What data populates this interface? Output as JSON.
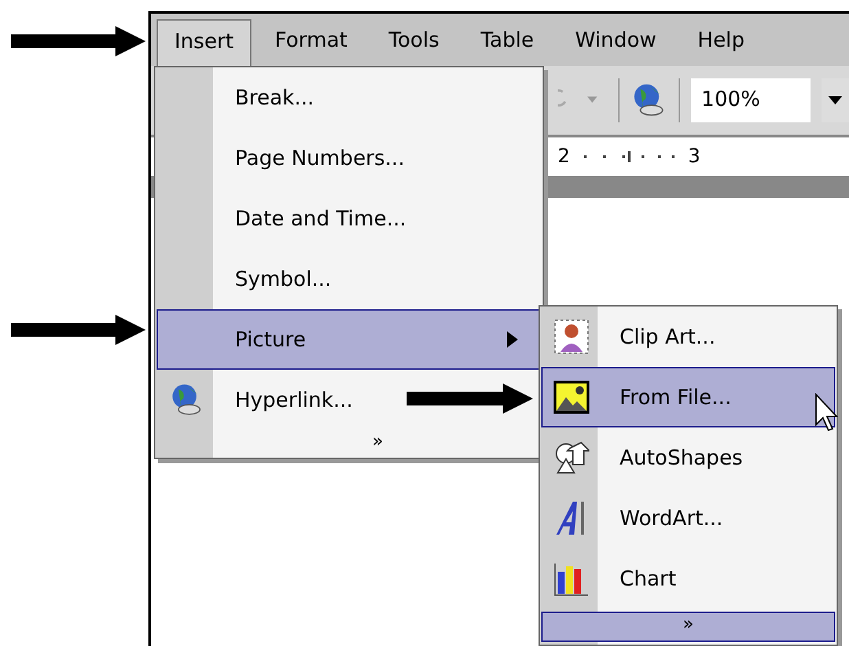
{
  "menu_bar": [
    {
      "label": "Insert",
      "selected": true
    },
    {
      "label": "Format",
      "selected": false
    },
    {
      "label": "Tools",
      "selected": false
    },
    {
      "label": "Table",
      "selected": false
    },
    {
      "label": "Window",
      "selected": false
    },
    {
      "label": "Help",
      "selected": false
    }
  ],
  "toolbar": {
    "zoom": "100%"
  },
  "ruler": {
    "marks": [
      "2",
      "3"
    ]
  },
  "insert_menu": {
    "items": [
      {
        "label": "Break...",
        "selected": false
      },
      {
        "label": "Page Numbers...",
        "selected": false
      },
      {
        "label": "Date and Time...",
        "selected": false
      },
      {
        "label": "Symbol...",
        "selected": false
      },
      {
        "label": "Picture",
        "selected": true,
        "kind": "submenu"
      },
      {
        "label": "Hyperlink...",
        "selected": false,
        "kind": "globe"
      }
    ],
    "more": "»"
  },
  "picture_menu": {
    "items": [
      {
        "label": "Clip Art...",
        "selected": false,
        "kind": "clipart"
      },
      {
        "label": "From File...",
        "selected": true,
        "kind": "photo"
      },
      {
        "label": "AutoShapes",
        "selected": false,
        "kind": "shapes"
      },
      {
        "label": "WordArt...",
        "selected": false,
        "kind": "wordart"
      },
      {
        "label": "Chart",
        "selected": false,
        "kind": "chart"
      }
    ],
    "more": "»"
  }
}
